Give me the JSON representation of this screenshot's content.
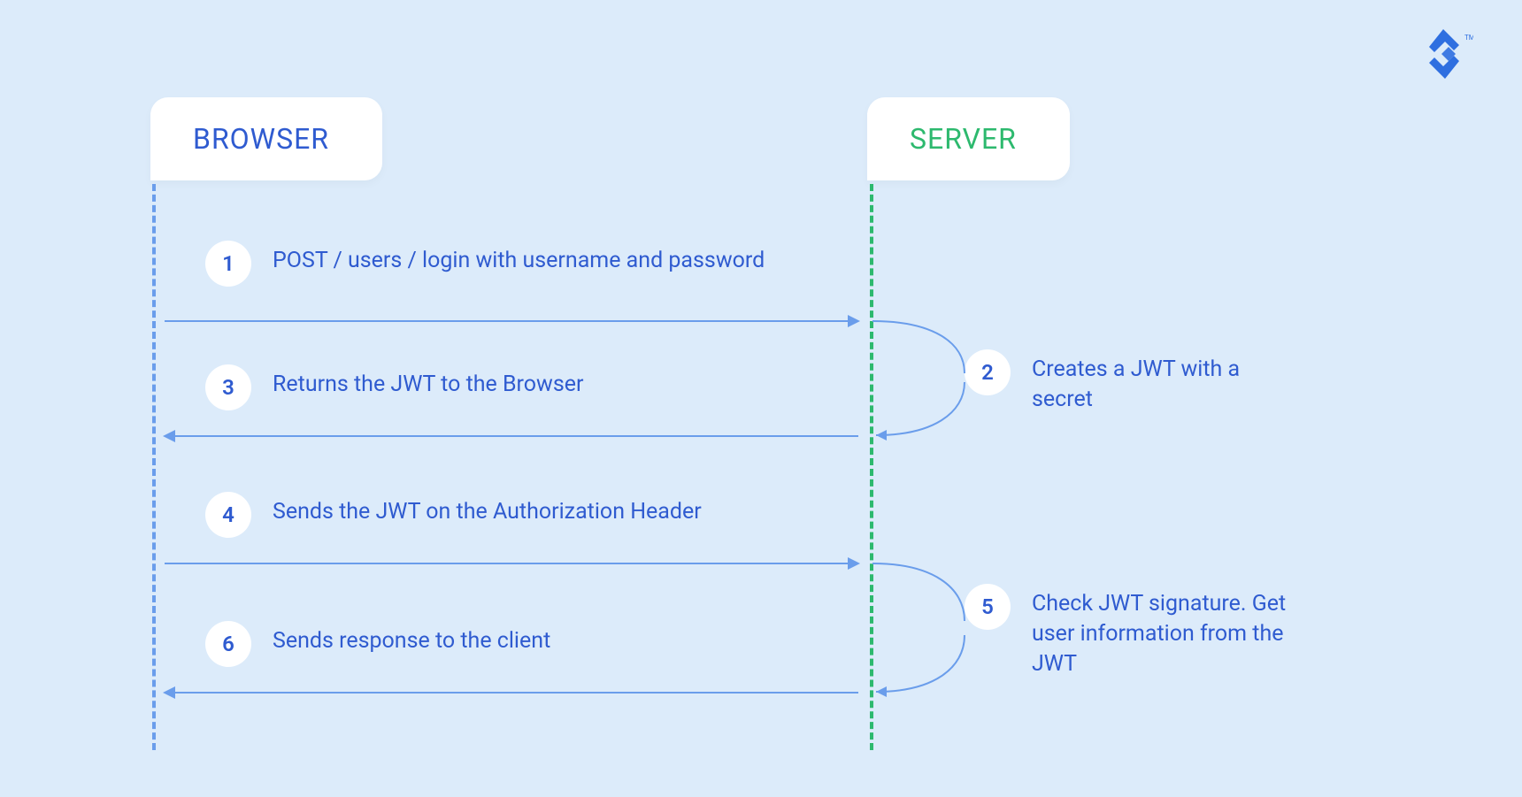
{
  "logo_name": "toptal-logo",
  "browser_label": "BROWSER",
  "server_label": "SERVER",
  "steps": {
    "s1": {
      "num": "1",
      "text": "POST / users / login with username and password"
    },
    "s2": {
      "num": "2",
      "text": "Creates a JWT with a secret"
    },
    "s3": {
      "num": "3",
      "text": "Returns the JWT to the Browser"
    },
    "s4": {
      "num": "4",
      "text": "Sends the JWT on the Authorization Header"
    },
    "s5": {
      "num": "5",
      "text": "Check JWT signature. Get user information from the JWT"
    },
    "s6": {
      "num": "6",
      "text": "Sends response to the client"
    }
  },
  "colors": {
    "browser": "#2F5BD0",
    "server": "#2DB96E",
    "arrow": "#6A9DEB",
    "bg": "#DCEBFA"
  }
}
